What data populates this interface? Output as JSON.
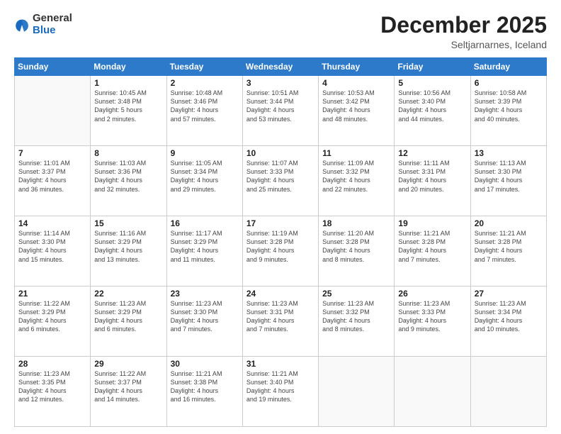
{
  "logo": {
    "general": "General",
    "blue": "Blue"
  },
  "header": {
    "month": "December 2025",
    "location": "Seltjarnarnes, Iceland"
  },
  "weekdays": [
    "Sunday",
    "Monday",
    "Tuesday",
    "Wednesday",
    "Thursday",
    "Friday",
    "Saturday"
  ],
  "weeks": [
    [
      {
        "day": "",
        "info": ""
      },
      {
        "day": "1",
        "info": "Sunrise: 10:45 AM\nSunset: 3:48 PM\nDaylight: 5 hours\nand 2 minutes."
      },
      {
        "day": "2",
        "info": "Sunrise: 10:48 AM\nSunset: 3:46 PM\nDaylight: 4 hours\nand 57 minutes."
      },
      {
        "day": "3",
        "info": "Sunrise: 10:51 AM\nSunset: 3:44 PM\nDaylight: 4 hours\nand 53 minutes."
      },
      {
        "day": "4",
        "info": "Sunrise: 10:53 AM\nSunset: 3:42 PM\nDaylight: 4 hours\nand 48 minutes."
      },
      {
        "day": "5",
        "info": "Sunrise: 10:56 AM\nSunset: 3:40 PM\nDaylight: 4 hours\nand 44 minutes."
      },
      {
        "day": "6",
        "info": "Sunrise: 10:58 AM\nSunset: 3:39 PM\nDaylight: 4 hours\nand 40 minutes."
      }
    ],
    [
      {
        "day": "7",
        "info": "Sunrise: 11:01 AM\nSunset: 3:37 PM\nDaylight: 4 hours\nand 36 minutes."
      },
      {
        "day": "8",
        "info": "Sunrise: 11:03 AM\nSunset: 3:36 PM\nDaylight: 4 hours\nand 32 minutes."
      },
      {
        "day": "9",
        "info": "Sunrise: 11:05 AM\nSunset: 3:34 PM\nDaylight: 4 hours\nand 29 minutes."
      },
      {
        "day": "10",
        "info": "Sunrise: 11:07 AM\nSunset: 3:33 PM\nDaylight: 4 hours\nand 25 minutes."
      },
      {
        "day": "11",
        "info": "Sunrise: 11:09 AM\nSunset: 3:32 PM\nDaylight: 4 hours\nand 22 minutes."
      },
      {
        "day": "12",
        "info": "Sunrise: 11:11 AM\nSunset: 3:31 PM\nDaylight: 4 hours\nand 20 minutes."
      },
      {
        "day": "13",
        "info": "Sunrise: 11:13 AM\nSunset: 3:30 PM\nDaylight: 4 hours\nand 17 minutes."
      }
    ],
    [
      {
        "day": "14",
        "info": "Sunrise: 11:14 AM\nSunset: 3:30 PM\nDaylight: 4 hours\nand 15 minutes."
      },
      {
        "day": "15",
        "info": "Sunrise: 11:16 AM\nSunset: 3:29 PM\nDaylight: 4 hours\nand 13 minutes."
      },
      {
        "day": "16",
        "info": "Sunrise: 11:17 AM\nSunset: 3:29 PM\nDaylight: 4 hours\nand 11 minutes."
      },
      {
        "day": "17",
        "info": "Sunrise: 11:19 AM\nSunset: 3:28 PM\nDaylight: 4 hours\nand 9 minutes."
      },
      {
        "day": "18",
        "info": "Sunrise: 11:20 AM\nSunset: 3:28 PM\nDaylight: 4 hours\nand 8 minutes."
      },
      {
        "day": "19",
        "info": "Sunrise: 11:21 AM\nSunset: 3:28 PM\nDaylight: 4 hours\nand 7 minutes."
      },
      {
        "day": "20",
        "info": "Sunrise: 11:21 AM\nSunset: 3:28 PM\nDaylight: 4 hours\nand 7 minutes."
      }
    ],
    [
      {
        "day": "21",
        "info": "Sunrise: 11:22 AM\nSunset: 3:29 PM\nDaylight: 4 hours\nand 6 minutes."
      },
      {
        "day": "22",
        "info": "Sunrise: 11:23 AM\nSunset: 3:29 PM\nDaylight: 4 hours\nand 6 minutes."
      },
      {
        "day": "23",
        "info": "Sunrise: 11:23 AM\nSunset: 3:30 PM\nDaylight: 4 hours\nand 7 minutes."
      },
      {
        "day": "24",
        "info": "Sunrise: 11:23 AM\nSunset: 3:31 PM\nDaylight: 4 hours\nand 7 minutes."
      },
      {
        "day": "25",
        "info": "Sunrise: 11:23 AM\nSunset: 3:32 PM\nDaylight: 4 hours\nand 8 minutes."
      },
      {
        "day": "26",
        "info": "Sunrise: 11:23 AM\nSunset: 3:33 PM\nDaylight: 4 hours\nand 9 minutes."
      },
      {
        "day": "27",
        "info": "Sunrise: 11:23 AM\nSunset: 3:34 PM\nDaylight: 4 hours\nand 10 minutes."
      }
    ],
    [
      {
        "day": "28",
        "info": "Sunrise: 11:23 AM\nSunset: 3:35 PM\nDaylight: 4 hours\nand 12 minutes."
      },
      {
        "day": "29",
        "info": "Sunrise: 11:22 AM\nSunset: 3:37 PM\nDaylight: 4 hours\nand 14 minutes."
      },
      {
        "day": "30",
        "info": "Sunrise: 11:21 AM\nSunset: 3:38 PM\nDaylight: 4 hours\nand 16 minutes."
      },
      {
        "day": "31",
        "info": "Sunrise: 11:21 AM\nSunset: 3:40 PM\nDaylight: 4 hours\nand 19 minutes."
      },
      {
        "day": "",
        "info": ""
      },
      {
        "day": "",
        "info": ""
      },
      {
        "day": "",
        "info": ""
      }
    ]
  ]
}
